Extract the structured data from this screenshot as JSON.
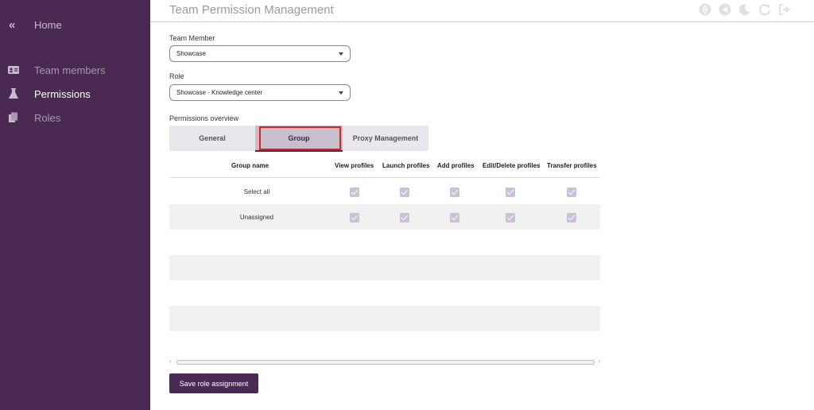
{
  "sidebar": {
    "home": "Home",
    "items": [
      {
        "label": "Team members",
        "icon": "id-card-icon"
      },
      {
        "label": "Permissions",
        "icon": "flask-icon"
      },
      {
        "label": "Roles",
        "icon": "copy-icon"
      }
    ],
    "active": "Permissions",
    "background": "#4a2a52"
  },
  "header": {
    "title": "Team Permission Management",
    "icons": [
      "recycle-icon",
      "telegram-icon",
      "moon-icon",
      "refresh-icon",
      "logout-icon"
    ]
  },
  "form": {
    "team_member_label": "Team Member",
    "team_member_value": "Showcase",
    "role_label": "Role",
    "role_value": "Showcase - Knowledge center"
  },
  "permissions": {
    "overview_label": "Permissions overview",
    "tabs": [
      "General",
      "Group",
      "Proxy Management"
    ],
    "active_tab": "Group",
    "columns": [
      "Group name",
      "View profiles",
      "Launch profiles",
      "Add profiles",
      "Edit/Delete profiles",
      "Transfer profiles"
    ],
    "rows": [
      {
        "name": "Select all",
        "checks": [
          true,
          true,
          true,
          true,
          true
        ]
      },
      {
        "name": "Unassigned",
        "checks": [
          true,
          true,
          true,
          true,
          true
        ]
      }
    ]
  },
  "save_button": "Save role assignment",
  "colors": {
    "accent": "#4a2a52",
    "checkbox": "#cdbfd6",
    "highlight": "#e02020"
  }
}
